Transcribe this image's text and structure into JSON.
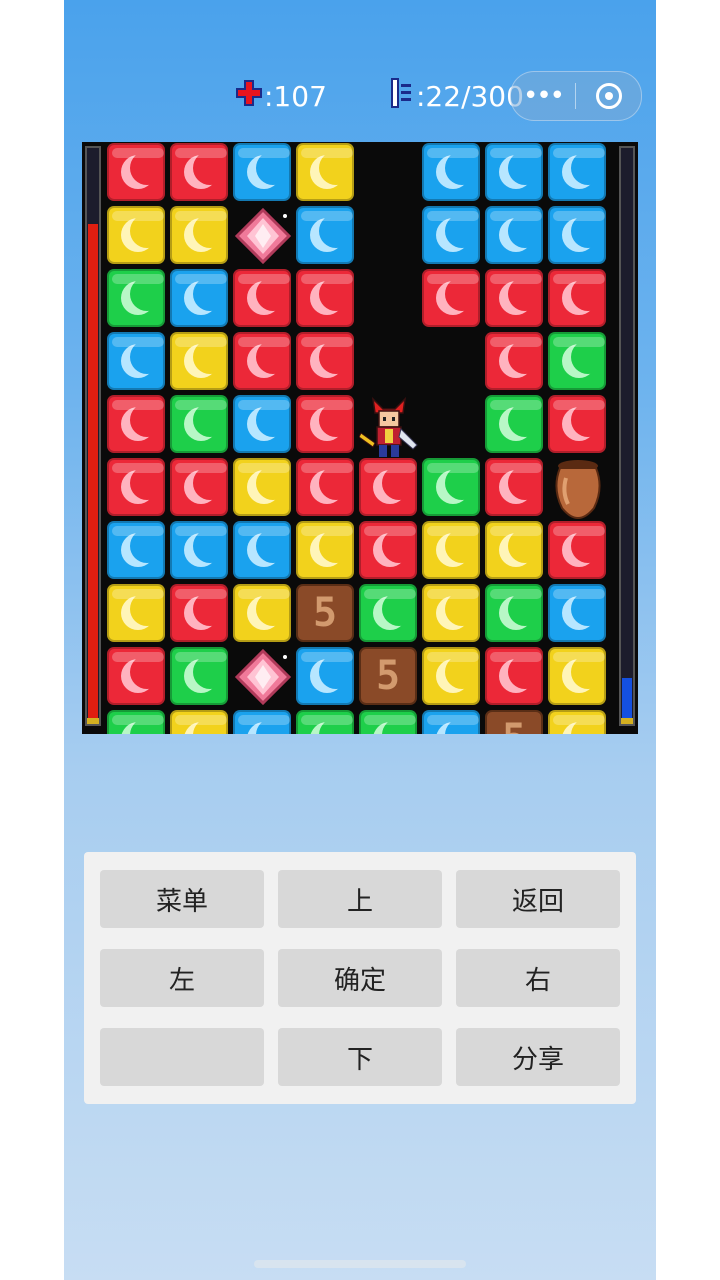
{
  "hud": {
    "hp_icon": "red-cross-icon",
    "hp_text": ":107",
    "floor_icon": "tower-icon",
    "floor_text": ":22/300"
  },
  "capsule": {
    "more_icon": "more-dots-icon",
    "close_icon": "target-circle-icon"
  },
  "bars": {
    "hp_level": 0.87,
    "mp_level": 0.07
  },
  "colors": {
    "red": "#ec2838",
    "blue": "#1aa2ee",
    "yellow": "#f2d21c",
    "green": "#1ecf4a",
    "box": "#8a4a28"
  },
  "board": {
    "rows": [
      [
        "red",
        "red",
        "blue",
        "yellow",
        "empty",
        "blue",
        "blue",
        "blue"
      ],
      [
        "yellow",
        "yellow",
        "gem",
        "blue",
        "empty",
        "blue",
        "blue",
        "blue"
      ],
      [
        "green",
        "blue",
        "red",
        "red",
        "empty",
        "red",
        "red",
        "red"
      ],
      [
        "blue",
        "yellow",
        "red",
        "red",
        "empty",
        "empty",
        "red",
        "green"
      ],
      [
        "red",
        "green",
        "blue",
        "red",
        "hero",
        "empty",
        "green",
        "red"
      ],
      [
        "red",
        "red",
        "yellow",
        "red",
        "red",
        "green",
        "red",
        "jar"
      ],
      [
        "blue",
        "blue",
        "blue",
        "yellow",
        "red",
        "yellow",
        "yellow",
        "red"
      ],
      [
        "yellow",
        "red",
        "yellow",
        "box",
        "green",
        "yellow",
        "green",
        "blue"
      ],
      [
        "red",
        "green",
        "gem",
        "blue",
        "box",
        "yellow",
        "red",
        "yellow"
      ],
      [
        "green",
        "yellow",
        "blue",
        "green",
        "green",
        "blue",
        "box",
        "yellow"
      ]
    ],
    "box_label": "5"
  },
  "controls": [
    {
      "label": "菜单",
      "name": "menu-button"
    },
    {
      "label": "上",
      "name": "up-button"
    },
    {
      "label": "返回",
      "name": "back-button"
    },
    {
      "label": "左",
      "name": "left-button"
    },
    {
      "label": "确定",
      "name": "confirm-button"
    },
    {
      "label": "右",
      "name": "right-button"
    },
    {
      "label": "",
      "name": "blank-button"
    },
    {
      "label": "下",
      "name": "down-button"
    },
    {
      "label": "分享",
      "name": "share-button"
    }
  ]
}
